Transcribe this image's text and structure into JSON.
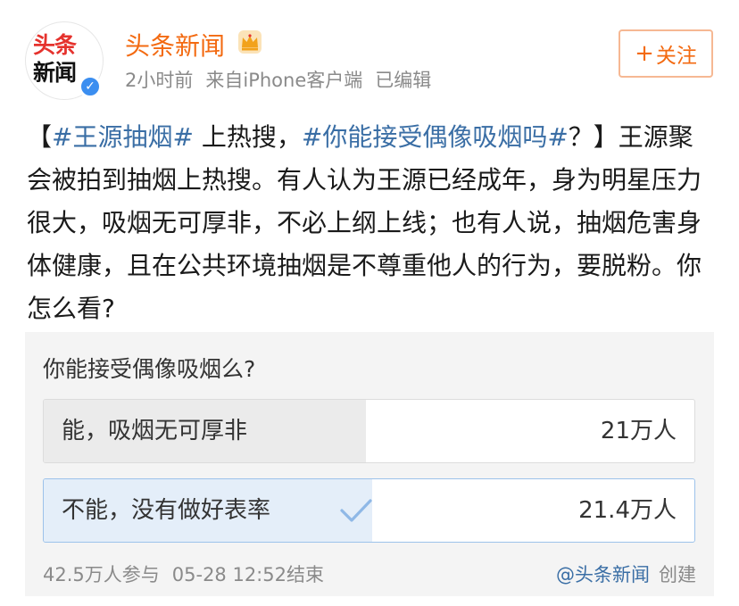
{
  "header": {
    "avatar_line1": "头条",
    "avatar_line2": "新闻",
    "username": "头条新闻",
    "time": "2小时前",
    "source": "来自iPhone客户端",
    "edited": "已编辑",
    "follow_plus": "+",
    "follow_label": "关注",
    "verified_icon": "verified-v-icon",
    "crown_icon": "crown-vip-icon"
  },
  "post": {
    "bracket_open": "【",
    "hashtag1": "#王源抽烟#",
    "text1": " 上热搜，",
    "hashtag2": "#你能接受偶像吸烟吗#",
    "text2": "？】王源聚会被拍到抽烟上热搜。有人认为王源已经成年，身为明星压力很大，吸烟无可厚非，不必上纲上线；也有人说，抽烟危害身体健康，且在公共环境抽烟是不尊重他人的行为，要脱粉。你怎么看?"
  },
  "poll": {
    "question": "你能接受偶像吸烟么?",
    "options": [
      {
        "label": "能，吸烟无可厚非",
        "count": "21万人",
        "share": 0.495
      },
      {
        "label": "不能，没有做好表率",
        "count": "21.4万人",
        "share": 0.505,
        "selected": true
      }
    ],
    "participants": "42.5万人参与",
    "end_time": "05-28 12:52结束",
    "creator": "@头条新闻",
    "created_label": "创建"
  },
  "colors": {
    "brand_orange": "#f36a11",
    "hashtag_blue": "#3a6ea5",
    "selected_blue": "#9cc2ea",
    "verified_blue": "#3b8ef0"
  }
}
